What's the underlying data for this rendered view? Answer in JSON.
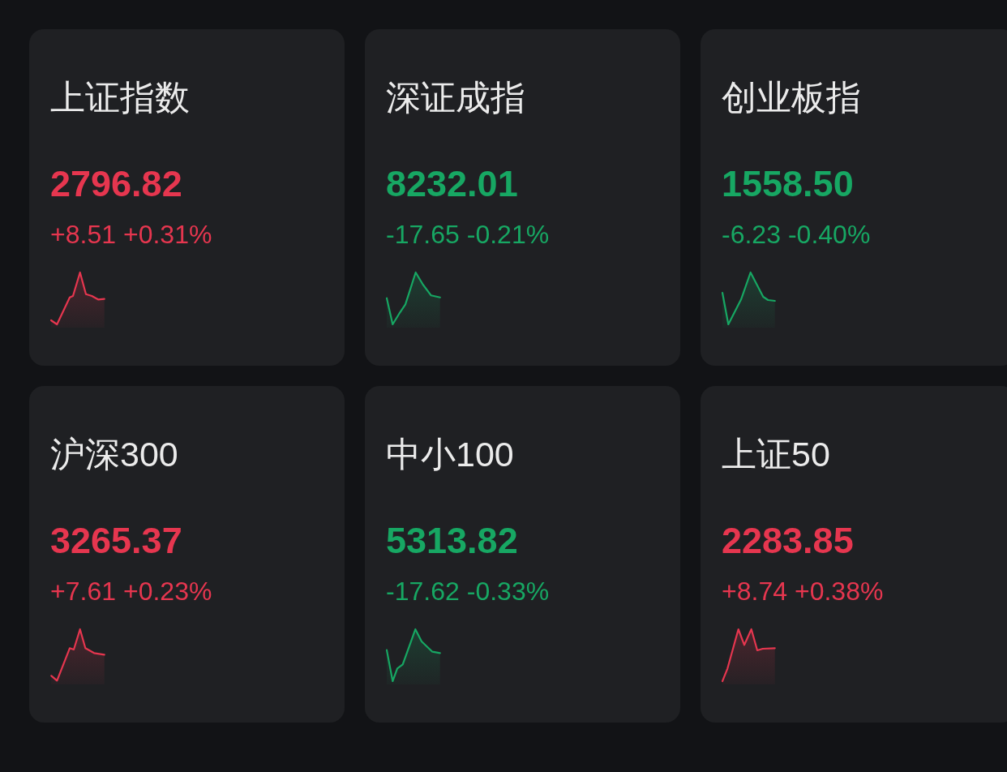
{
  "cards": [
    {
      "name": "上证指数",
      "value": "2796.82",
      "change": "+8.51",
      "change_percent": "+0.31%",
      "rising": true
    },
    {
      "name": "深证成指",
      "value": "8232.01",
      "change": "-17.65",
      "change_percent": "-0.21%",
      "rising": false
    },
    {
      "name": "创业板指",
      "value": "1558.50",
      "change": "-6.23",
      "change_percent": "-0.40%",
      "rising": false
    },
    {
      "name": "沪深300",
      "value": "3265.37",
      "change": "+7.61",
      "change_percent": "+0.23%",
      "rising": true
    },
    {
      "name": "中小100",
      "value": "5313.82",
      "change": "-17.62",
      "change_percent": "-0.33%",
      "rising": false
    },
    {
      "name": "上证50",
      "value": "2283.85",
      "change": "+8.74",
      "change_percent": "+0.38%",
      "rising": true
    }
  ]
}
